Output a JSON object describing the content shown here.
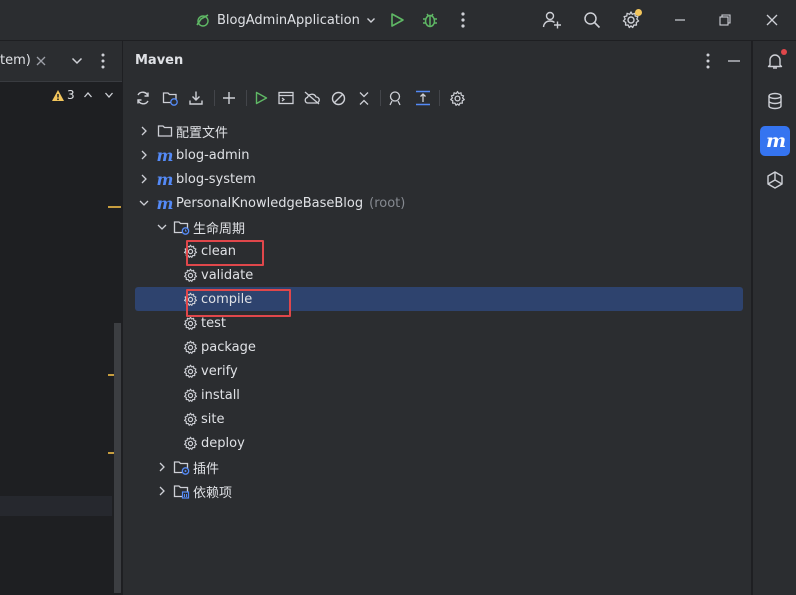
{
  "titlebar": {
    "run_config": "BlogAdminApplication"
  },
  "editor": {
    "tab_label": "tem)",
    "warning_count": "3"
  },
  "maven": {
    "title": "Maven",
    "tree": [
      {
        "label": "配置文件",
        "kind": "folder",
        "expanded": false
      },
      {
        "label": "blog-admin",
        "kind": "module",
        "expanded": false
      },
      {
        "label": "blog-system",
        "kind": "module",
        "expanded": false
      },
      {
        "label": "PersonalKnowledgeBaseBlog",
        "suffix": "(root)",
        "kind": "module",
        "expanded": true
      },
      {
        "label": "生命周期",
        "kind": "lifecycle-folder",
        "expanded": true
      },
      {
        "label": "clean",
        "kind": "goal",
        "highlighted": true
      },
      {
        "label": "validate",
        "kind": "goal"
      },
      {
        "label": "compile",
        "kind": "goal",
        "selected": true,
        "highlighted": true
      },
      {
        "label": "test",
        "kind": "goal"
      },
      {
        "label": "package",
        "kind": "goal"
      },
      {
        "label": "verify",
        "kind": "goal"
      },
      {
        "label": "install",
        "kind": "goal"
      },
      {
        "label": "site",
        "kind": "goal"
      },
      {
        "label": "deploy",
        "kind": "goal"
      },
      {
        "label": "插件",
        "kind": "plugins-folder",
        "expanded": false
      },
      {
        "label": "依赖项",
        "kind": "deps-folder",
        "expanded": false
      }
    ]
  },
  "colors": {
    "background": "#2b2d30",
    "editor_bg": "#1e1f22",
    "selection": "#2e436e",
    "highlight_box": "#e0474b",
    "maven_blue": "#548af7",
    "run_green": "#5fb865",
    "warning_yellow": "#f2c55c"
  }
}
